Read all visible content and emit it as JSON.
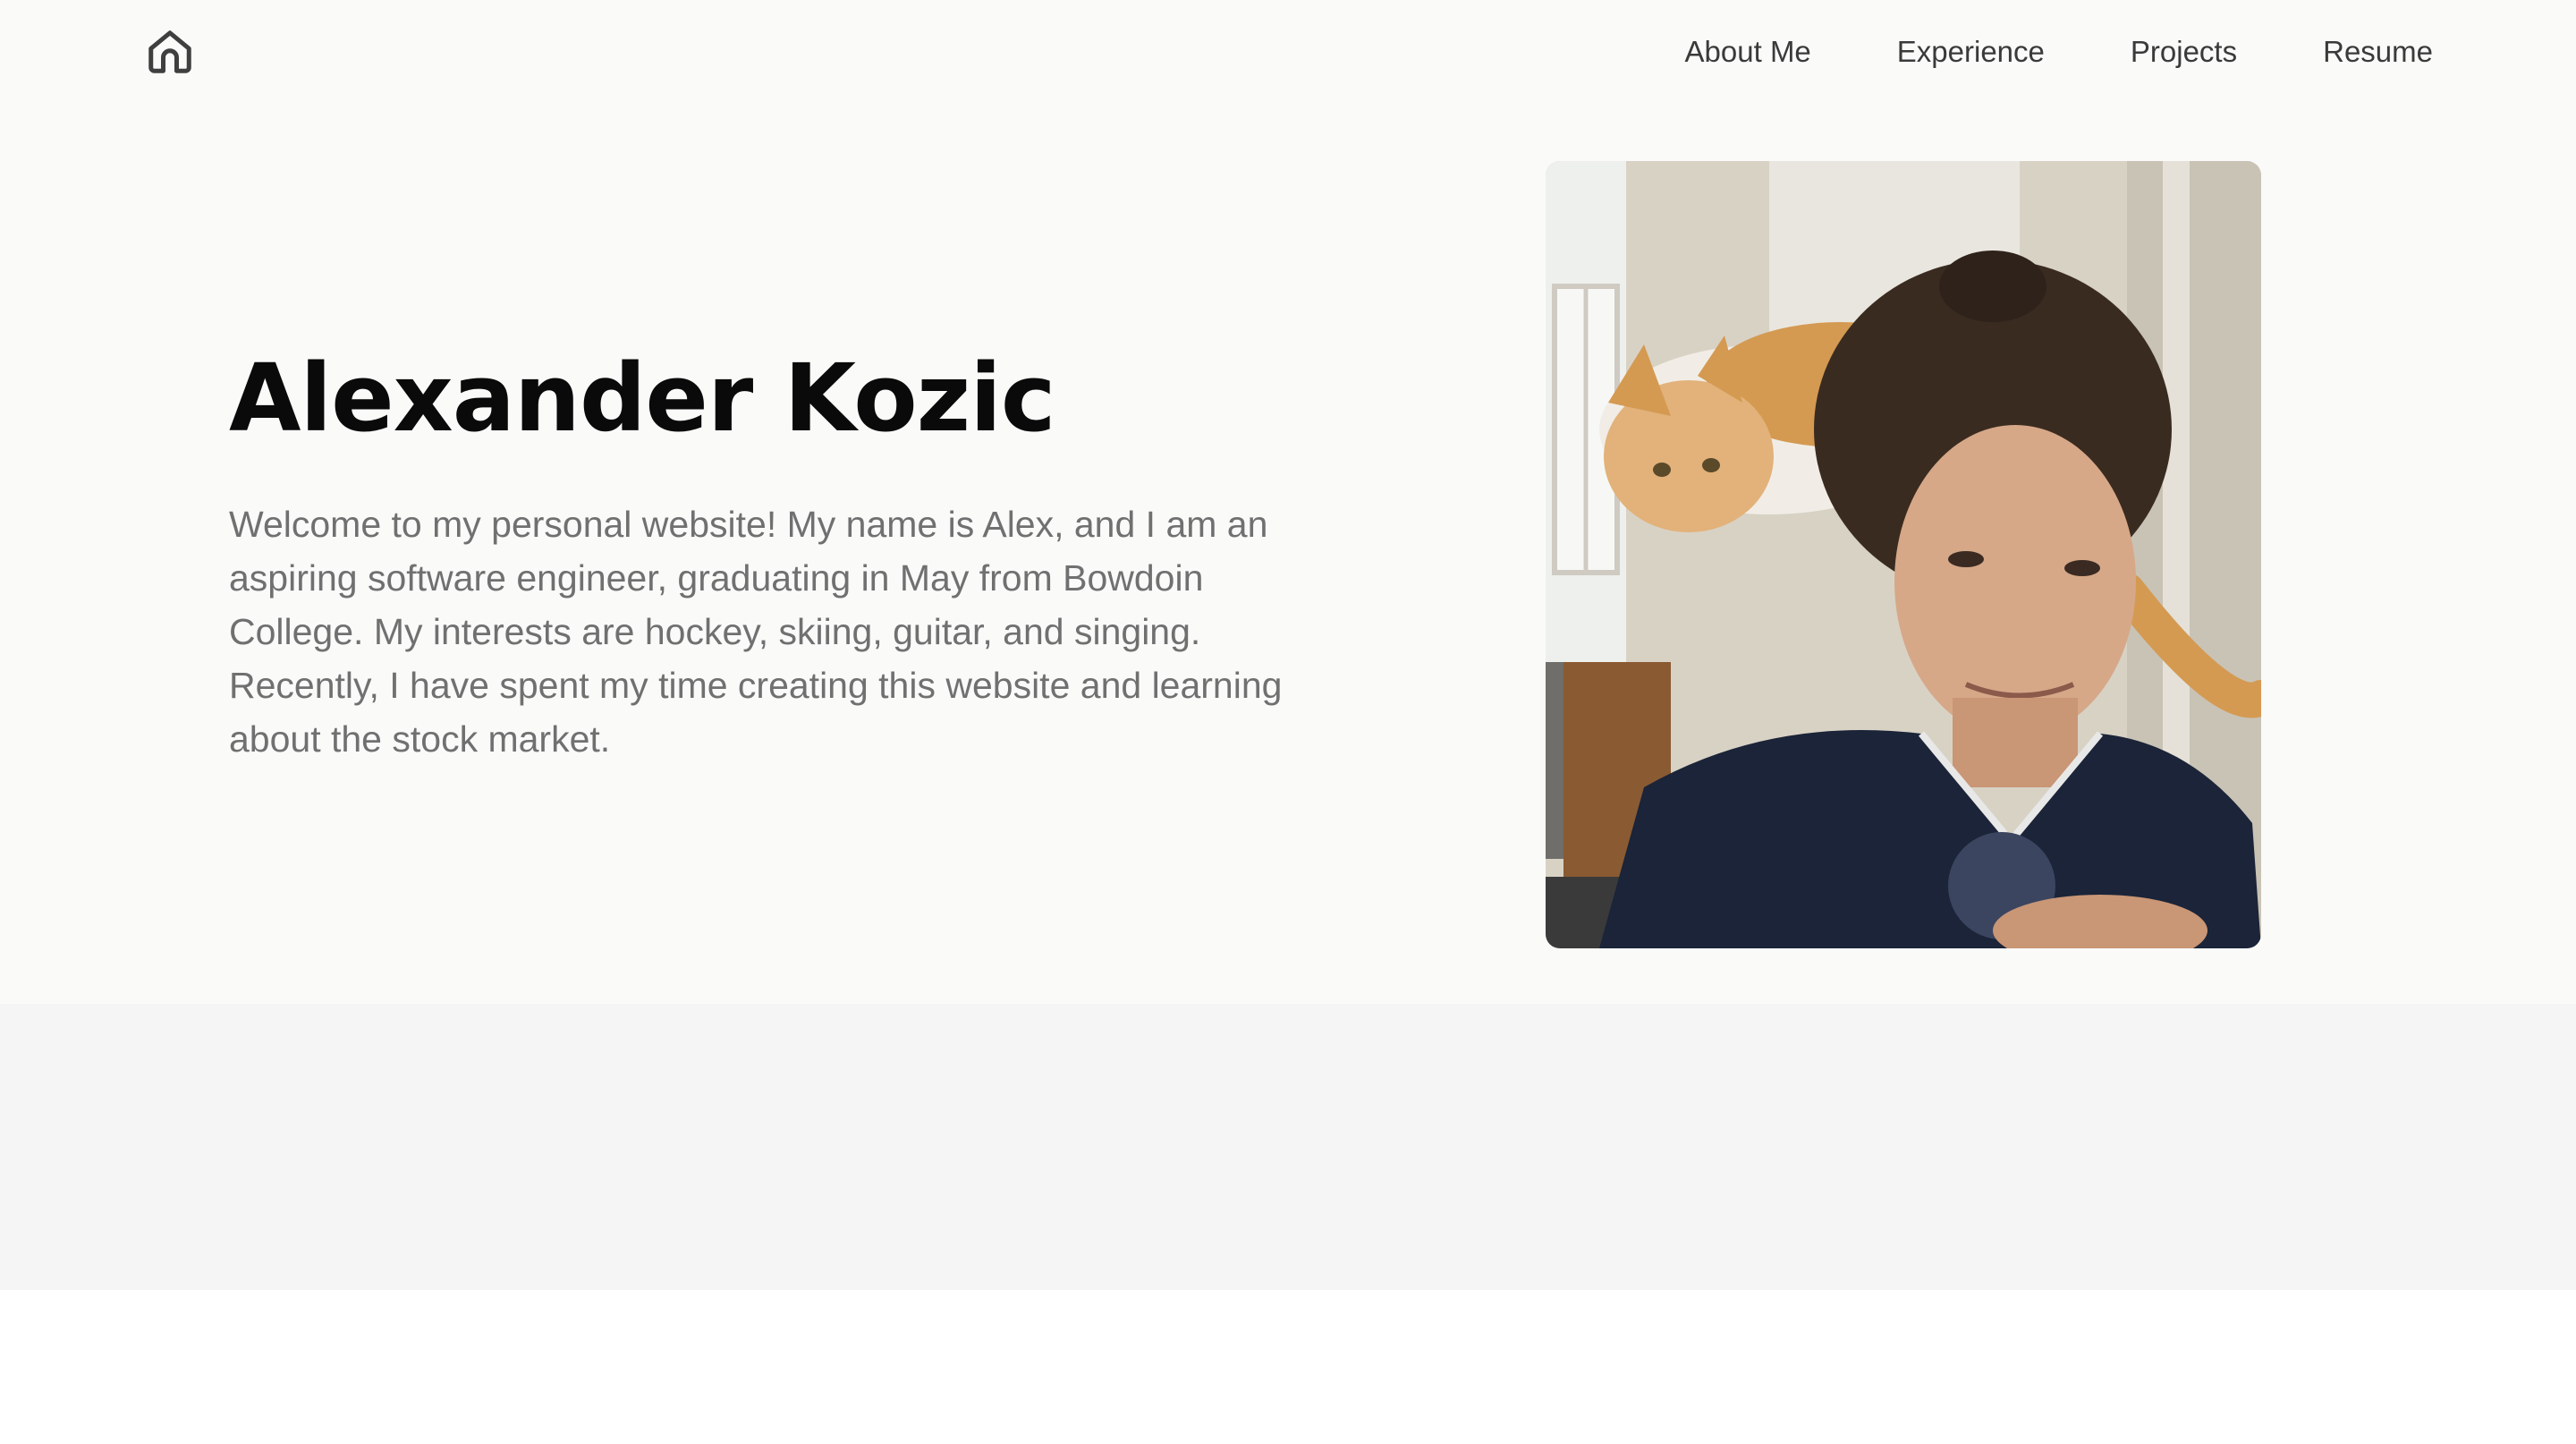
{
  "nav": {
    "home_icon": "home-icon",
    "links": [
      {
        "label": "About Me"
      },
      {
        "label": "Experience"
      },
      {
        "label": "Projects"
      },
      {
        "label": "Resume"
      }
    ]
  },
  "hero": {
    "name": "Alexander Kozic",
    "bio": "Welcome to my personal website! My name is Alex, and I am an aspiring software engineer, graduating in May from Bowdoin College. My interests are hockey, skiing, guitar, and singing. Recently, I have spent my time creating this website and learning about the stock market."
  },
  "colors": {
    "hero_background": "#fafaf9",
    "band_background": "#f5f5f5",
    "heading": "#0a0a0a",
    "body_text": "#707070",
    "nav_text": "#3a3a3a"
  }
}
